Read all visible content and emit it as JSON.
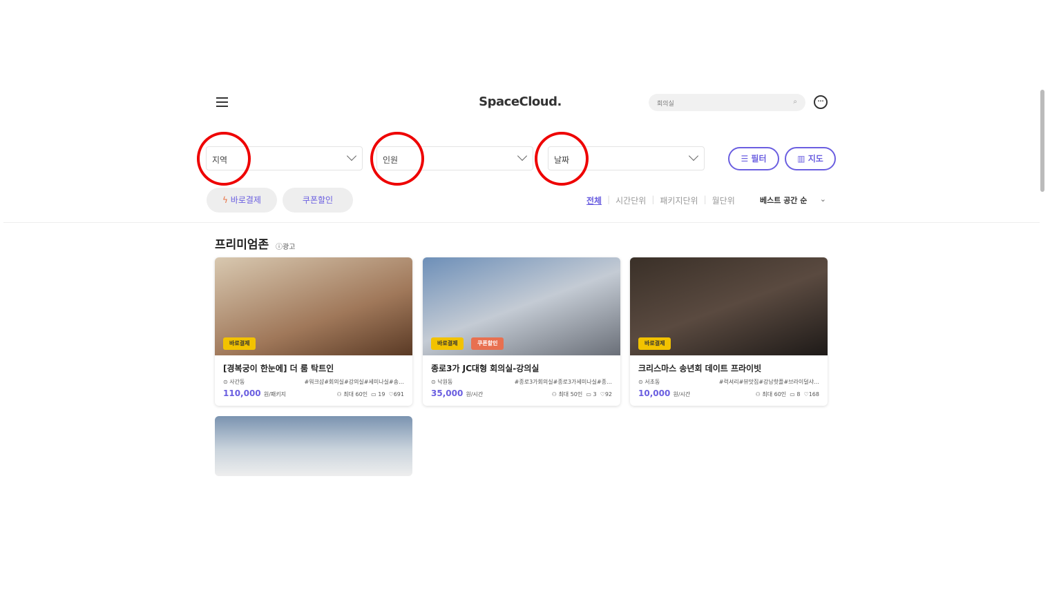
{
  "header": {
    "logo": "SpaceCloud.",
    "search_value": "회의실"
  },
  "filters": {
    "region": "지역",
    "people": "인원",
    "date": "날짜",
    "filter_btn": "필터",
    "map_btn": "지도"
  },
  "chips": {
    "instant": "바로결제",
    "coupon": "쿠폰할인"
  },
  "tabs": [
    "전체",
    "시간단위",
    "패키지단위",
    "월단위"
  ],
  "sort": "베스트 공간 순",
  "section": {
    "title": "프리미엄존",
    "ad": "광고"
  },
  "cards": [
    {
      "title": "[경복궁이 한눈에] 더 룸 탁트인",
      "location": "사간동",
      "tags": "#워크샵#회의실#강의실#세미나실#송…",
      "price": "110,000",
      "unit": "원/패키지",
      "capacity": "최대 60인",
      "reviews": "19",
      "likes": "691",
      "badges": [
        "바로결제"
      ]
    },
    {
      "title": "종로3가 JC대형 회의실-강의실",
      "location": "낙원동",
      "tags": "#종로3가회의실#종로3가세미나실#종…",
      "price": "35,000",
      "unit": "원/시간",
      "capacity": "최대 50인",
      "reviews": "3",
      "likes": "92",
      "badges": [
        "바로결제",
        "쿠폰할인"
      ]
    },
    {
      "title": "크리스마스 송년회 데이트 프라이빗",
      "location": "서초동",
      "tags": "#럭셔리#뷰맛집#강남핫플#브라이덜샤…",
      "price": "10,000",
      "unit": "원/시간",
      "capacity": "최대 60인",
      "reviews": "8",
      "likes": "168",
      "badges": [
        "바로결제"
      ]
    }
  ]
}
